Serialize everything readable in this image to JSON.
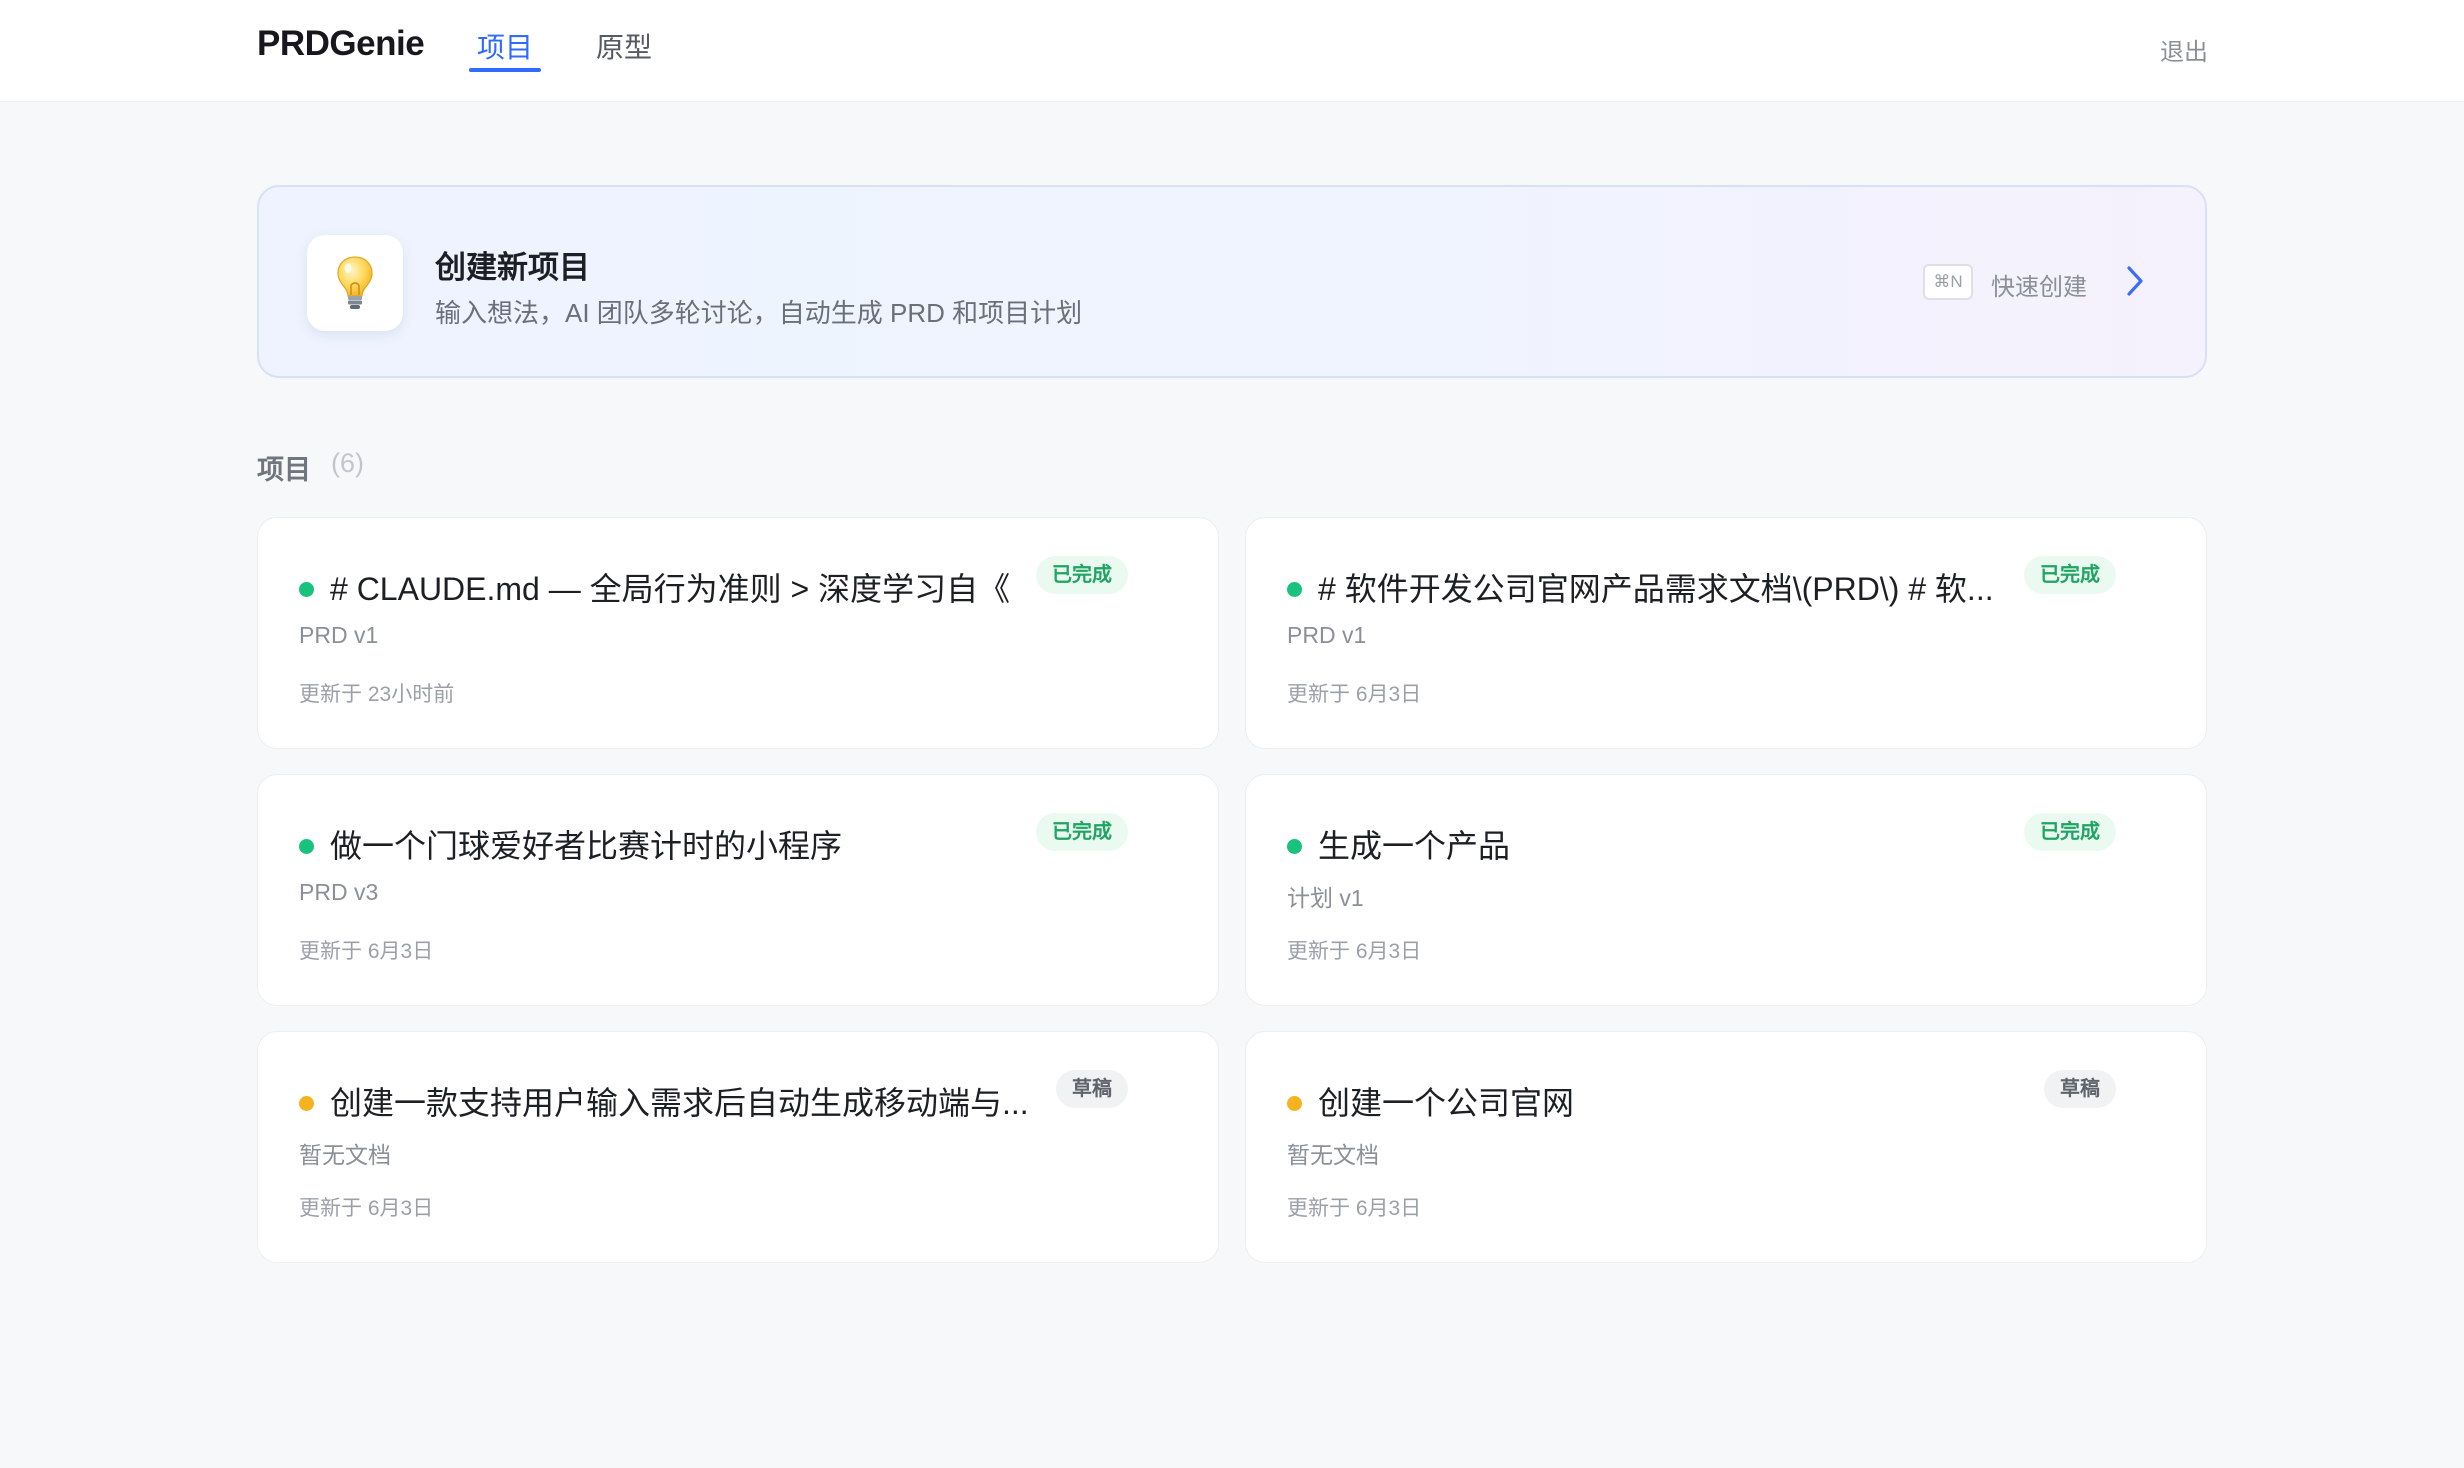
{
  "header": {
    "logo": "PRDGenie",
    "tabs": [
      {
        "label": "项目",
        "active": true
      },
      {
        "label": "原型",
        "active": false
      }
    ],
    "logout_label": "退出"
  },
  "create_card": {
    "icon": "lightbulb-icon",
    "title": "创建新项目",
    "description": "输入想法，AI 团队多轮讨论，自动生成 PRD 和项目计划",
    "shortcut": "⌘N",
    "quick_label": "快速创建"
  },
  "projects_section": {
    "title": "项目",
    "count": "(6)"
  },
  "projects": [
    {
      "title": "# CLAUDE.md — 全局行为准则 > 深度学习自《",
      "status": "已完成",
      "status_color": "#19c37d",
      "document": "PRD v1",
      "updated": "更新于 23小时前"
    },
    {
      "title": "# 软件开发公司官网产品需求文档\\(PRD\\) # 软...",
      "status": "已完成",
      "status_color": "#19c37d",
      "document": "PRD v1",
      "updated": "更新于 6月3日"
    },
    {
      "title": "做一个门球爱好者比赛计时的小程序",
      "status": "已完成",
      "status_color": "#19c37d",
      "document": "PRD v3",
      "updated": "更新于 6月3日"
    },
    {
      "title": "生成一个产品",
      "status": "已完成",
      "status_color": "#19c37d",
      "document": "计划 v1",
      "updated": "更新于 6月3日"
    },
    {
      "title": "创建一款支持用户输入需求后自动生成移动端与...",
      "status": "草稿",
      "status_color": "#f5b41f",
      "document": "暂无文档",
      "updated": "更新于 6月3日"
    },
    {
      "title": "创建一个公司官网",
      "status": "草稿",
      "status_color": "#f5b41f",
      "document": "暂无文档",
      "updated": "更新于 6月3日"
    }
  ],
  "colors": {
    "accent": "#2f6bff",
    "done_badge_bg": "#eafaf1",
    "done_badge_text": "#1fa463",
    "draft_badge_bg": "#f1f2f4",
    "draft_badge_text": "#5f646c"
  }
}
